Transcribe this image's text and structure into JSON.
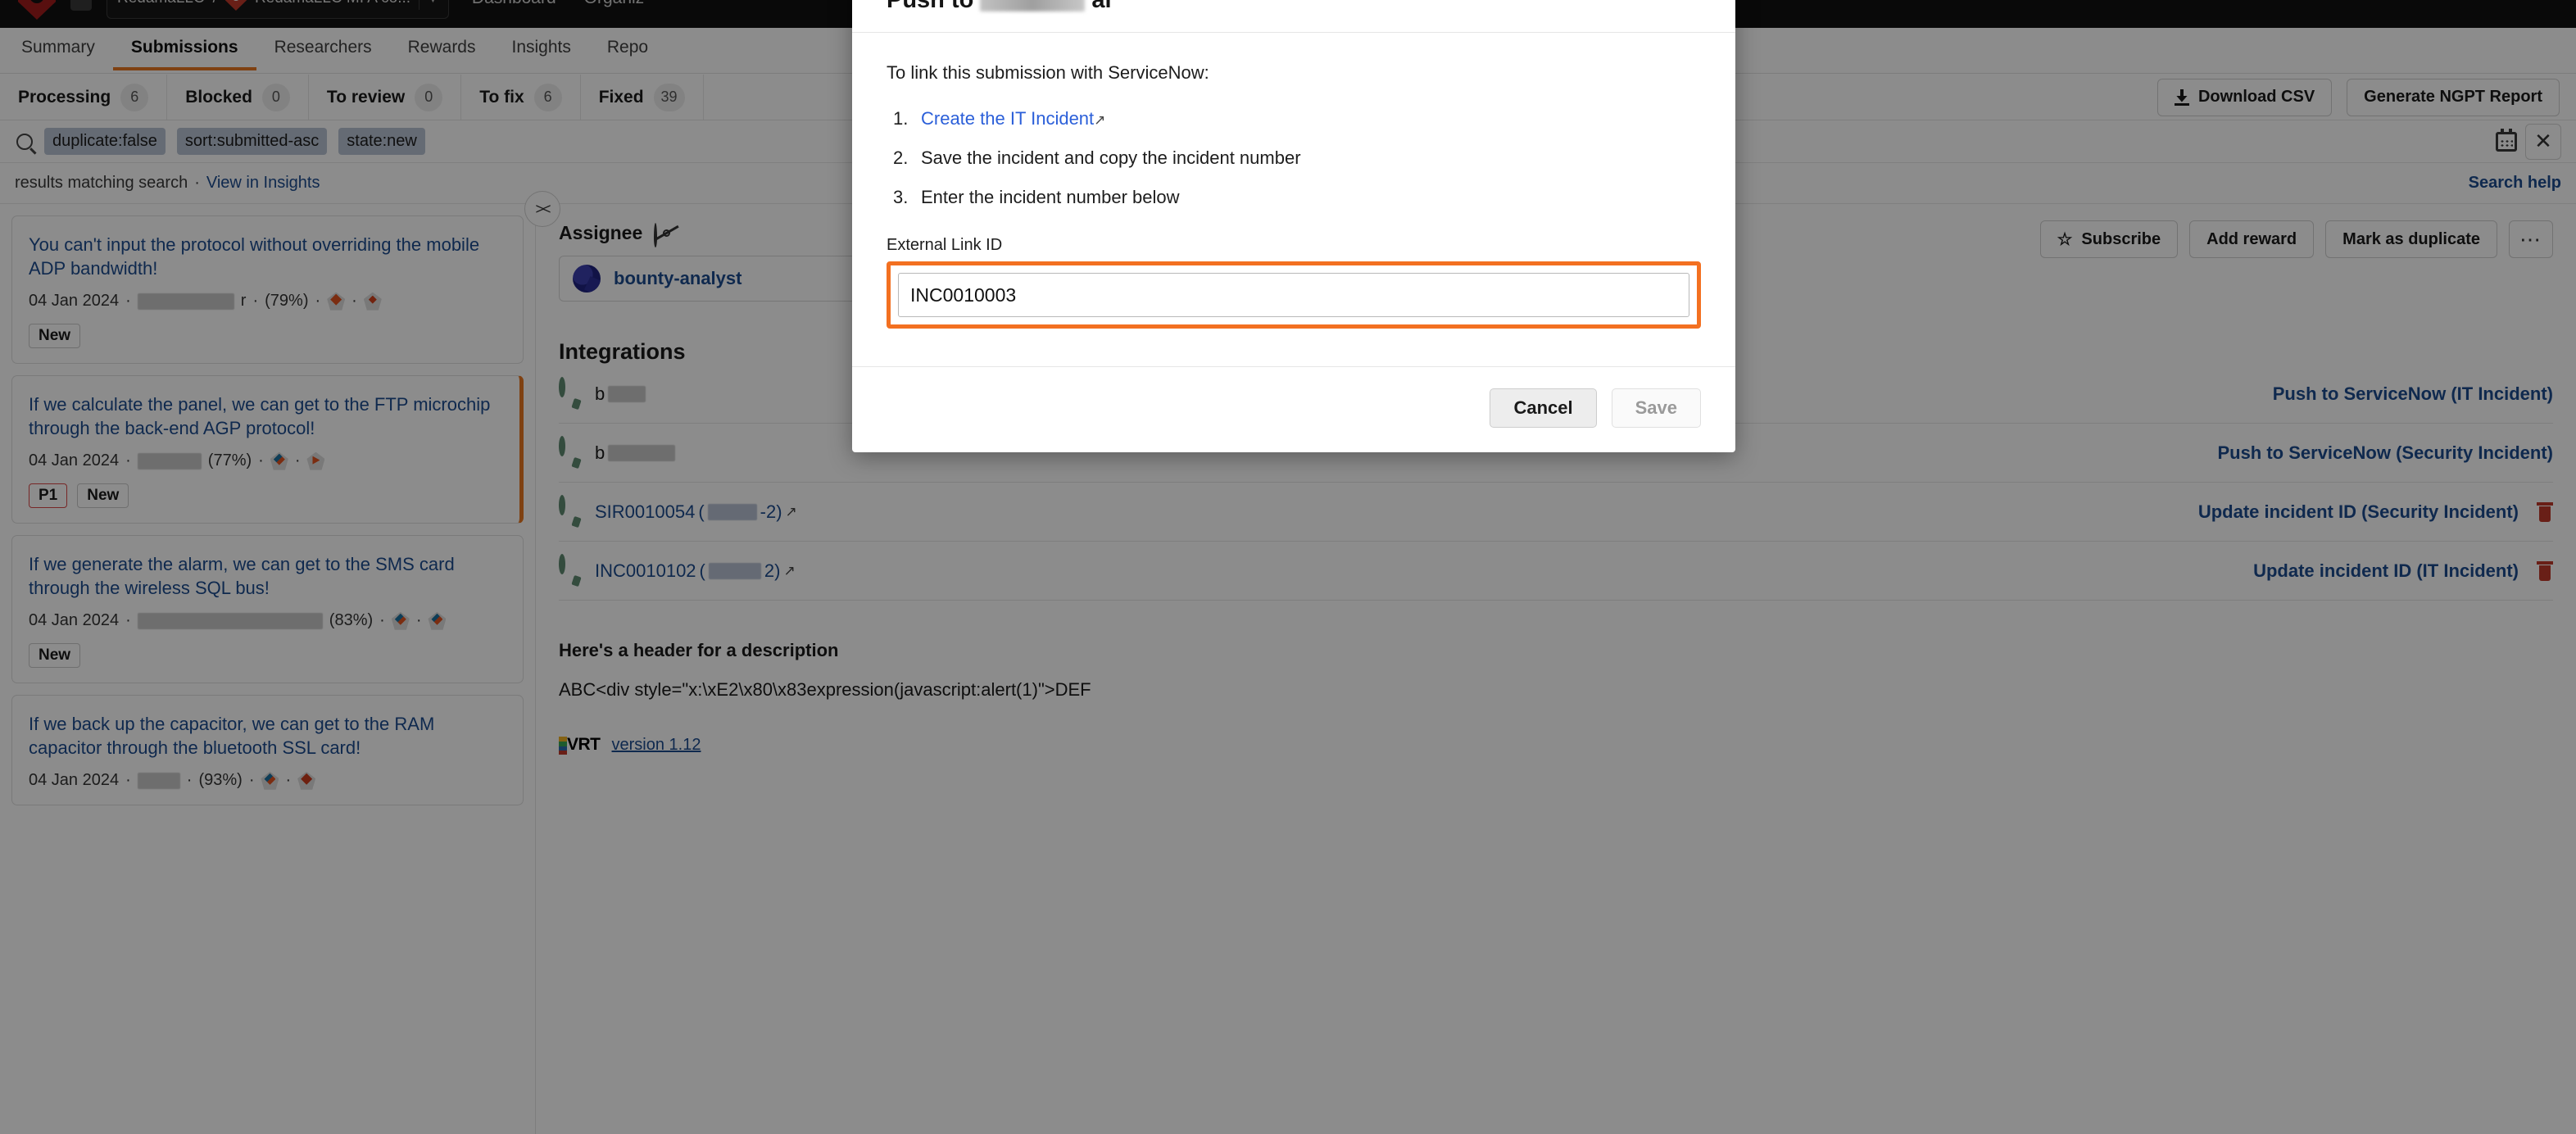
{
  "topnav": {
    "breadcrumb_org": "RedamaLLC",
    "breadcrumb_program": "RedamaLLC MI A co...",
    "links": [
      "Dashboard",
      "Organiz"
    ]
  },
  "program_tabs": [
    {
      "label": "Summary",
      "active": false
    },
    {
      "label": "Submissions",
      "active": true
    },
    {
      "label": "Researchers",
      "active": false
    },
    {
      "label": "Rewards",
      "active": false
    },
    {
      "label": "Insights",
      "active": false
    },
    {
      "label": "Repo",
      "active": false
    }
  ],
  "filter_tabs": [
    {
      "label": "Processing",
      "count": "6"
    },
    {
      "label": "Blocked",
      "count": "0"
    },
    {
      "label": "To review",
      "count": "0"
    },
    {
      "label": "To fix",
      "count": "6"
    },
    {
      "label": "Fixed",
      "count": "39"
    }
  ],
  "toolbar": {
    "download_csv": "Download CSV",
    "generate_report": "Generate NGPT Report"
  },
  "search": {
    "chips": [
      "duplicate:false",
      "sort:submitted-asc",
      "state:new"
    ],
    "results_text": "results matching search",
    "separator": "·",
    "insights_link": "View in Insights",
    "search_help": "Search help"
  },
  "submissions": [
    {
      "title": "You can't input the protocol without overriding the mobile ADP bandwidth!",
      "date": "04 Jan 2024",
      "researcher_suffix": "r",
      "percent": "(79%)",
      "tags": [
        "New"
      ],
      "selected": false,
      "redact_width": 118
    },
    {
      "title": "If we calculate the panel, we can get to the FTP microchip through the back-end AGP protocol!",
      "date": "04 Jan 2024",
      "researcher_suffix": "",
      "percent": "(77%)",
      "tags": [
        "P1",
        "New"
      ],
      "selected": true,
      "redact_width": 78
    },
    {
      "title": "If we generate the alarm, we can get to the SMS card through the wireless SQL bus!",
      "date": "04 Jan 2024",
      "researcher_suffix": "",
      "percent": "(83%)",
      "tags": [
        "New"
      ],
      "selected": false,
      "redact_width": 226
    },
    {
      "title": "If we back up the capacitor, we can get to the RAM capacitor through the bluetooth SSL card!",
      "date": "04 Jan 2024",
      "researcher_suffix": "",
      "percent": "(93%)",
      "tags": [],
      "selected": false,
      "redact_width": 52
    }
  ],
  "detail": {
    "assignee_label": "Assignee",
    "assignee_name": "bounty-analyst",
    "actions": {
      "subscribe": "Subscribe",
      "add_reward": "Add reward",
      "mark_duplicate": "Mark as duplicate",
      "more": "•••"
    },
    "integrations_title": "Integrations",
    "integrations": [
      {
        "label_prefix": "b",
        "redact_width": 46,
        "id": "",
        "action": "Push to ServiceNow (IT Incident)",
        "has_trash": false,
        "external": false
      },
      {
        "label_prefix": "b",
        "redact_width": 82,
        "id": "",
        "action": "Push to ServiceNow (Security Incident)",
        "has_trash": false,
        "external": false
      },
      {
        "label_prefix": "",
        "redact_width": 60,
        "id": "SIR0010054",
        "suffix": "-2)",
        "action": "Update incident ID (Security Incident)",
        "has_trash": true,
        "external": true
      },
      {
        "label_prefix": "",
        "redact_width": 64,
        "id": "INC0010102",
        "suffix": "2)",
        "action": "Update incident ID (IT Incident)",
        "has_trash": true,
        "external": true
      }
    ],
    "description_header": "Here's a header for a description",
    "description_body": "ABC<div style=\"x:\\xE2\\x80\\x83expression(javascript:alert(1)\">DEF",
    "vrt_label": "VRT",
    "vrt_version": "version 1.12"
  },
  "modal": {
    "title_prefix": "Push to",
    "title_suffix": "al",
    "lead": "To link this submission with ServiceNow:",
    "steps": [
      {
        "num": "1.",
        "text": "Create the IT Incident",
        "is_link": true,
        "external": true
      },
      {
        "num": "2.",
        "text": "Save the incident and copy the incident number",
        "is_link": false,
        "external": false
      },
      {
        "num": "3.",
        "text": "Enter the incident number below",
        "is_link": false,
        "external": false
      }
    ],
    "field_label": "External Link ID",
    "field_value": "INC0010003",
    "field_placeholder": "",
    "cancel": "Cancel",
    "save": "Save"
  },
  "colors": {
    "accent_orange": "#f37021",
    "link_blue": "#1c4b8f",
    "modal_link": "#2b5fd9",
    "servicenow_green": "#5f8a72",
    "danger_red": "#c0392b"
  }
}
